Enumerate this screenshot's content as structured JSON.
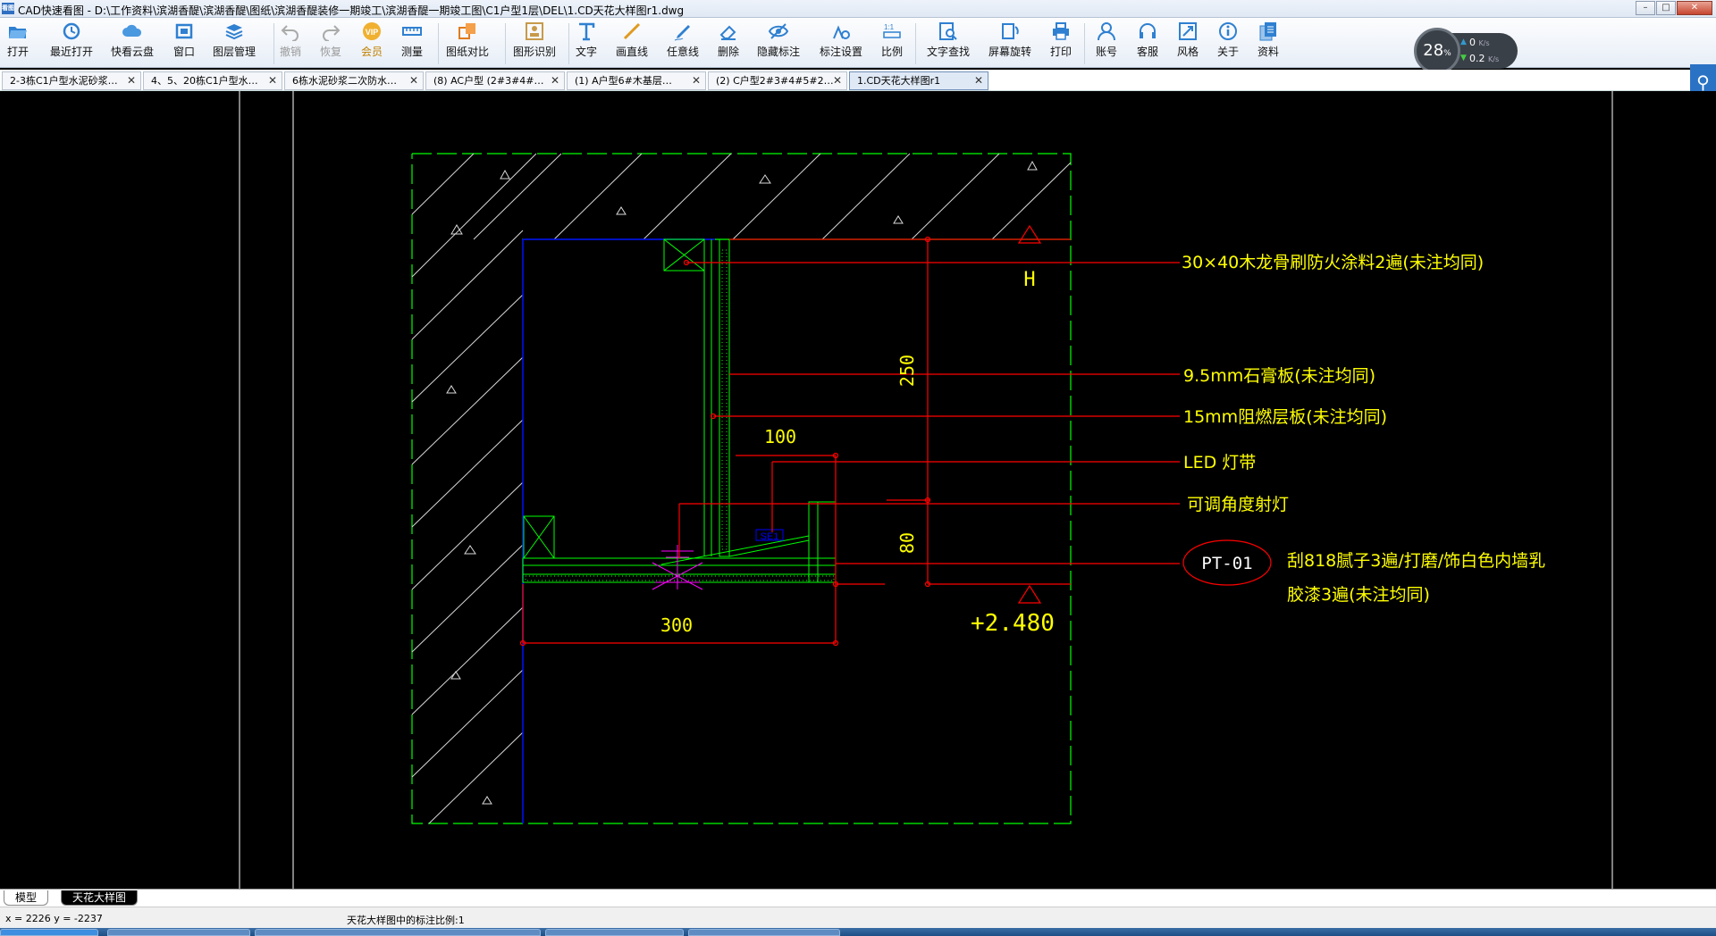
{
  "window": {
    "title": "CAD快速看图 - D:\\工作资料\\滨湖香醍\\滨湖香醍\\图纸\\滨湖香醍装修一期竣工\\滨湖香醍一期竣工图\\C1户型1层\\DEL\\1.CD天花大样图r1.dwg",
    "icon_label": "看图"
  },
  "toolbar": {
    "items": [
      {
        "label": "打开",
        "icon": "folder-open-icon",
        "enabled": true
      },
      {
        "label": "最近打开",
        "icon": "history-icon",
        "enabled": true
      },
      {
        "label": "快看云盘",
        "icon": "cloud-icon",
        "enabled": true
      },
      {
        "label": "窗口",
        "icon": "window-icon",
        "enabled": true
      },
      {
        "label": "图层管理",
        "icon": "layers-icon",
        "enabled": true
      },
      {
        "label": "撤销",
        "icon": "undo-icon",
        "enabled": false
      },
      {
        "label": "恢复",
        "icon": "redo-icon",
        "enabled": false
      },
      {
        "label": "会员",
        "icon": "vip-icon",
        "enabled": true
      },
      {
        "label": "测量",
        "icon": "ruler-icon",
        "enabled": true
      },
      {
        "label": "图纸对比",
        "icon": "compare-icon",
        "enabled": true
      },
      {
        "label": "图形识别",
        "icon": "shape-recognize-icon",
        "enabled": true
      },
      {
        "label": "文字",
        "icon": "text-icon",
        "enabled": true
      },
      {
        "label": "画直线",
        "icon": "line-icon",
        "enabled": true
      },
      {
        "label": "任意线",
        "icon": "pen-icon",
        "enabled": true
      },
      {
        "label": "删除",
        "icon": "eraser-icon",
        "enabled": true
      },
      {
        "label": "隐藏标注",
        "icon": "hide-annotation-icon",
        "enabled": true
      },
      {
        "label": "标注设置",
        "icon": "annotation-settings-icon",
        "enabled": true
      },
      {
        "label": "比例",
        "icon": "scale-icon",
        "enabled": true
      },
      {
        "label": "文字查找",
        "icon": "text-search-icon",
        "enabled": true
      },
      {
        "label": "屏幕旋转",
        "icon": "rotate-screen-icon",
        "enabled": true
      },
      {
        "label": "打印",
        "icon": "printer-icon",
        "enabled": true
      },
      {
        "label": "账号",
        "icon": "user-icon",
        "enabled": true
      },
      {
        "label": "客服",
        "icon": "headset-icon",
        "enabled": true
      },
      {
        "label": "风格",
        "icon": "style-icon",
        "enabled": true
      },
      {
        "label": "关于",
        "icon": "info-icon",
        "enabled": true
      },
      {
        "label": "资料",
        "icon": "documents-icon",
        "enabled": true
      }
    ]
  },
  "speed_widget": {
    "percent": "28",
    "percent_unit": "%",
    "upload": "0",
    "upload_unit": "K/s",
    "download": "0.2",
    "download_unit": "K/s"
  },
  "tabs": [
    {
      "label": "2-3栋C1户型水泥砂浆…",
      "active": false
    },
    {
      "label": "4、5、20栋C1户型水…",
      "active": false
    },
    {
      "label": "6栋水泥砂浆二次防水…",
      "active": false
    },
    {
      "label": "(8) AC户型 (2#3#4#…",
      "active": false
    },
    {
      "label": "(1) A户型6#木基层…",
      "active": false
    },
    {
      "label": "(2) C户型2#3#4#5#2…",
      "active": false
    },
    {
      "label": "1.CD天花大样图r1",
      "active": true
    }
  ],
  "drawing": {
    "dim_250": "250",
    "dim_100": "100",
    "dim_80": "80",
    "dim_300": "300",
    "marker_h": "H",
    "elevation": "+2.480",
    "block_label": "SE1",
    "callout_1": "30×40木龙骨刷防火涂料2遍(未注均同)",
    "callout_2": "9.5mm石膏板(未注均同)",
    "callout_3": "15mm阻燃层板(未注均同)",
    "callout_4": "LED 灯带",
    "callout_5": "可调角度射灯",
    "finish_tag": "PT-01",
    "finish_line1": "刮818腻子3遍/打磨/饰白色内墙乳",
    "finish_line2": "胶漆3遍(未注均同)",
    "colors": {
      "wall": "#00ff00",
      "leader": "#ff0000",
      "text": "#ffff00",
      "blue": "#0000ff",
      "magenta": "#ff00ff",
      "white": "#ffffff"
    }
  },
  "layout_tabs": {
    "model": "模型",
    "active": "天花大样图"
  },
  "status": {
    "coords": "x = 2226  y = -2237",
    "scale_text": "天花大样图中的标注比例:1"
  }
}
